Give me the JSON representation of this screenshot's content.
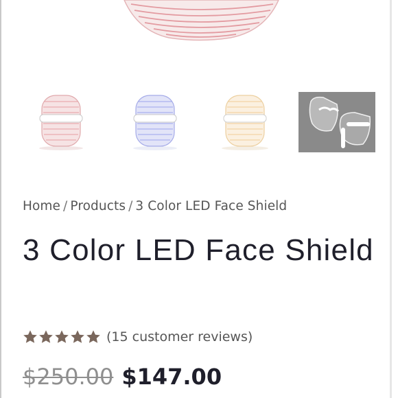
{
  "breadcrumb": {
    "home": "Home",
    "products": "Products",
    "current": "3 Color LED Face Shield",
    "separator": "/"
  },
  "product": {
    "title": "3 Color LED Face Shield",
    "rating": {
      "stars": 5,
      "max": 5,
      "reviews_text": "(15 customer reviews)"
    },
    "price": {
      "original": "$250.00",
      "sale": "$147.00"
    }
  },
  "gallery": {
    "thumbnails": [
      {
        "label": "red",
        "color": "#e7a5a8"
      },
      {
        "label": "blue",
        "color": "#9aa2ea"
      },
      {
        "label": "amber",
        "color": "#f0cf9c"
      },
      {
        "label": "clear",
        "color": "#8a8a8a"
      }
    ]
  },
  "colors": {
    "star": "#7a675c",
    "text": "#1f1f2b",
    "muted": "#8f8f8f"
  }
}
